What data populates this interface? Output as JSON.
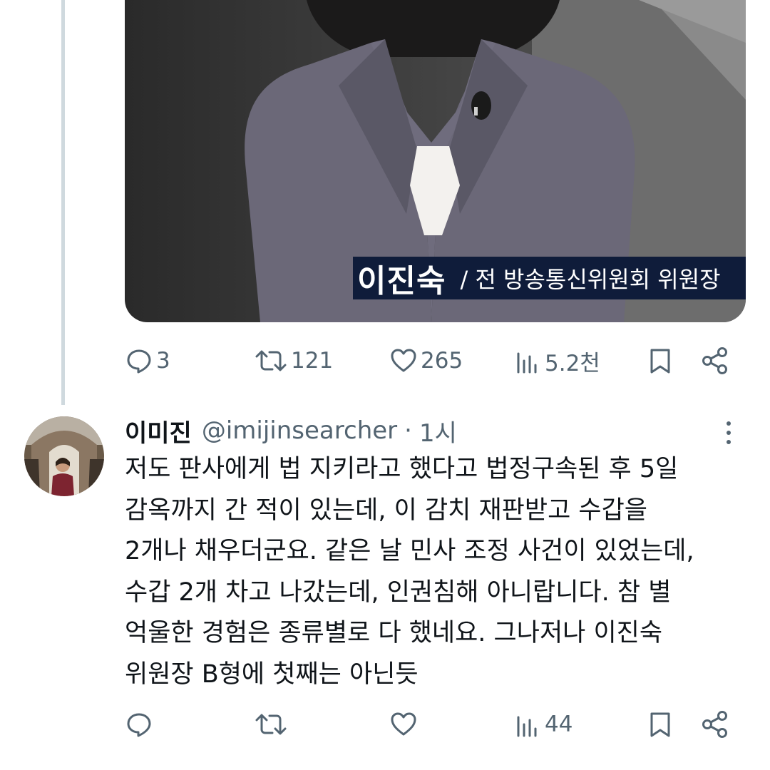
{
  "video": {
    "caption_name": "이진숙",
    "caption_title": "/ 전 방송통신위원회 위원장",
    "mute_icon": "speaker-muted-icon"
  },
  "tweet1_actions": {
    "replies": "3",
    "reposts": "121",
    "likes": "265",
    "views": "5.2천"
  },
  "reply": {
    "display_name": "이미진",
    "handle": "@imijinsearcher",
    "separator": "·",
    "time": "1시",
    "lines": [
      "저도 판사에게 법 지키라고 했다고 법정구속된 후 5일",
      "감옥까지 간 적이 있는데, 이 감치 재판받고 수갑을",
      "2개나 채우더군요. 같은 날 민사 조정 사건이 있었는데,",
      "수갑 2개 차고 나갔는데, 인권침해 아니랍니다. 참 별",
      "억울한 경험은 종류별로 다 했네요. 그나저나 이진숙",
      "위원장 B형에 첫째는 아닌듯"
    ],
    "actions": {
      "views": "44"
    }
  },
  "colors": {
    "icon_gray": "#536471",
    "text": "#0f1419",
    "thread_line": "#cfd9de",
    "caption_bg": "#0f1c3a"
  }
}
